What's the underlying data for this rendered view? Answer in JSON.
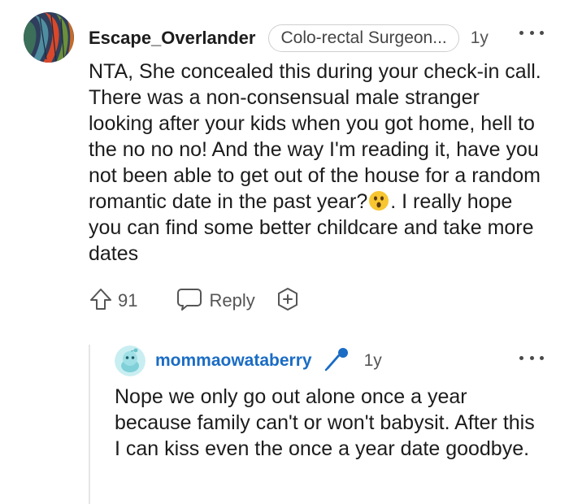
{
  "comment": {
    "username": "Escape_Overlander",
    "flair": "Colo-rectal Surgeon...",
    "age": "1y",
    "text_before_emoji": "NTA, She concealed this during your check-in call. There was a non-consensual male stranger looking after your kids when you got home, hell to the no no no! And the way I'm reading it, have you not been able to get out of the house for a random romantic date in the past year?",
    "emoji": "astonished-face-emoji",
    "text_after_emoji": ". I really hope you can find some better childcare and take more dates",
    "upvotes": "91",
    "reply_label": "Reply",
    "icons": {
      "upvote": "upvote-arrow-icon",
      "reply": "speech-bubble-icon",
      "award": "award-plus-icon",
      "more": "more-options-icon"
    }
  },
  "reply": {
    "username": "mommaowataberry",
    "age": "1y",
    "text": "Nope we only go out alone once a year because family can't or won't babysit. After this I can kiss even the once a year date goodbye.",
    "icons": {
      "badge": "microphone-icon",
      "more": "more-options-icon"
    },
    "colors": {
      "username": "#1a6cc4",
      "badge": "#1a6cc4"
    }
  }
}
